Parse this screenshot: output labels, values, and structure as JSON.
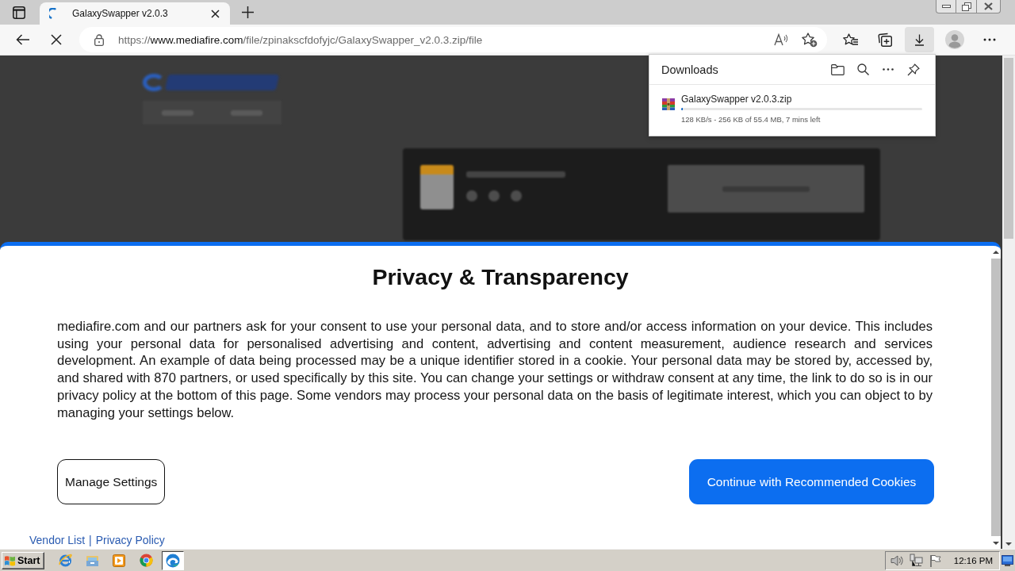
{
  "browser": {
    "tabs": [
      {
        "title": "GalaxySwapper v2.0.3",
        "selected": true,
        "loading": true
      }
    ],
    "address_bar": {
      "scheme": "https://",
      "host": "www.mediafire.com",
      "path": "/file/zpinakscfdofyjc/GalaxySwapper_v2.0.3.zip/file"
    },
    "downloads_button": {
      "selected": true
    }
  },
  "downloads_panel": {
    "title": "Downloads",
    "items": [
      {
        "name": "GalaxySwapper v2.0.3.zip",
        "level": 0.005,
        "status": "128 KB/s - 256 KB of 55.4 MB, 7 mins left"
      }
    ]
  },
  "consent_dialog": {
    "title": "Privacy & Transparency",
    "text": "mediafire.com and our partners ask for your consent to use your personal data, and to store and/or access information on your device. This includes using your personal data for personalised advertising and content, advertising and content measurement, audience research and services development. An example of data being processed may be a unique identifier stored in a cookie. Your personal data may be stored by, accessed by, and shared with 870 partners, or used specifically by this site. You can change your settings or withdraw consent at any time, the link to do so is in our privacy policy at the bottom of this page. Some vendors may process your personal data on the basis of legitimate interest, which you can object to by managing your settings below.",
    "buttons": [
      {
        "label": "Manage Settings",
        "kind": "outline"
      },
      {
        "label": "Continue with Recommended Cookies",
        "kind": "primary"
      }
    ],
    "links": [
      {
        "label": "Vendor List"
      },
      {
        "label": "Privacy Policy"
      }
    ],
    "link_separator": "|"
  },
  "taskbar": {
    "start_label": "Start",
    "apps": [
      {
        "kind": "ie",
        "selected": false
      },
      {
        "kind": "explorer",
        "selected": false
      },
      {
        "kind": "media",
        "selected": false
      },
      {
        "kind": "chrome",
        "selected": false
      },
      {
        "kind": "edge",
        "selected": true
      }
    ],
    "clock": "12:16 PM"
  }
}
